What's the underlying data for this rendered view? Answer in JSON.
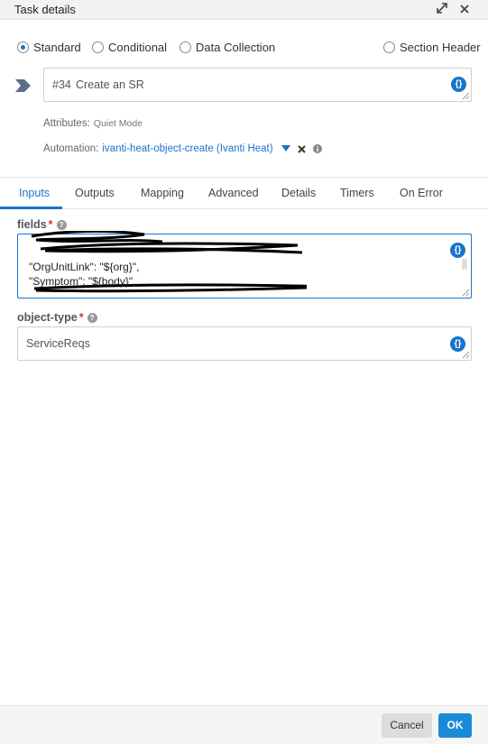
{
  "titlebar": {
    "title": "Task details",
    "expand_icon": "expand-icon",
    "close_icon": "close-icon"
  },
  "task_types": [
    {
      "label": "Standard",
      "selected": true
    },
    {
      "label": "Conditional",
      "selected": false
    },
    {
      "label": "Data Collection",
      "selected": false
    },
    {
      "label": "Section Header",
      "selected": false
    }
  ],
  "task": {
    "number": "#34",
    "name": "Create an SR"
  },
  "attributes": {
    "label": "Attributes:",
    "value": "Quiet Mode"
  },
  "automation": {
    "label": "Automation:",
    "value": "ivanti-heat-object-create (Ivanti Heat)"
  },
  "tabs": [
    "Inputs",
    "Outputs",
    "Mapping",
    "Advanced",
    "Details",
    "Timers",
    "On Error"
  ],
  "active_tab": "Inputs",
  "fields": {
    "label": "fields",
    "lines": [
      "\"OrgUnitLink\": \"${org}\",",
      "\"Symptom\": \"${body}\","
    ]
  },
  "object_type": {
    "label": "object-type",
    "value": "ServiceReqs"
  },
  "footer": {
    "cancel": "Cancel",
    "ok": "OK"
  },
  "colors": {
    "accent": "#1a73c8",
    "required": "#d9342b"
  }
}
